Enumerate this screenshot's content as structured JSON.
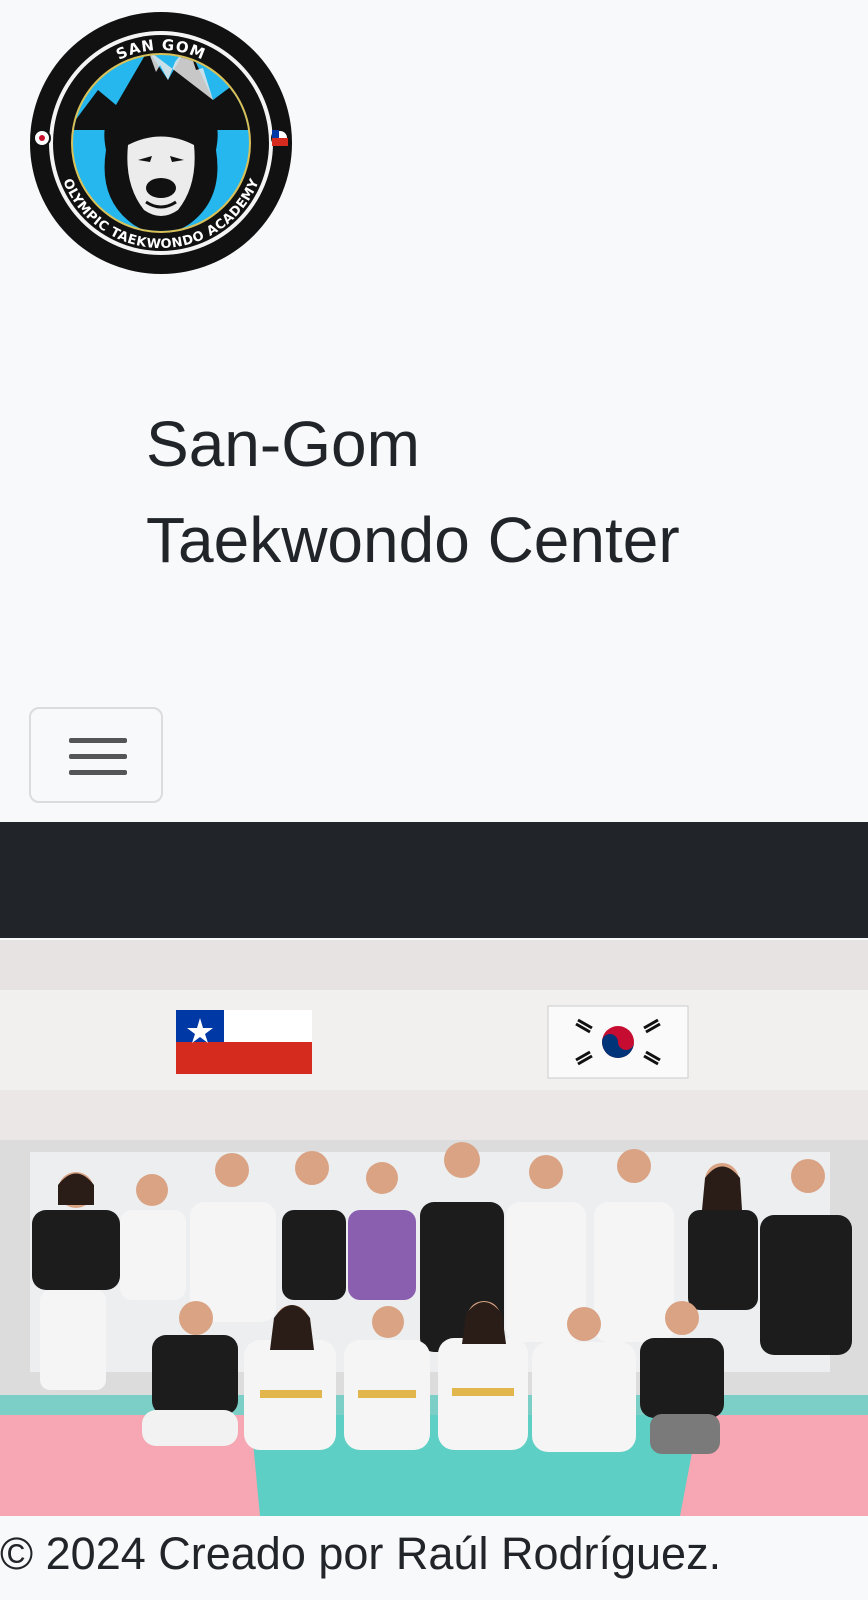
{
  "logo": {
    "top_text": "SAN GOM",
    "bottom_text": "OLYMPIC TAEKWONDO ACADEMY",
    "ring_color": "#111111",
    "fill_color": "#25b7ee"
  },
  "brand": {
    "line1": "San-Gom",
    "line2": "Taekwondo Center"
  },
  "navbar": {
    "toggler_icon": "hamburger-menu-icon",
    "dark_band_color": "#212529"
  },
  "hero": {
    "photo_alt": ""
  },
  "footer": {
    "copyright": "© 2024 Creado por Raúl Rodríguez."
  }
}
